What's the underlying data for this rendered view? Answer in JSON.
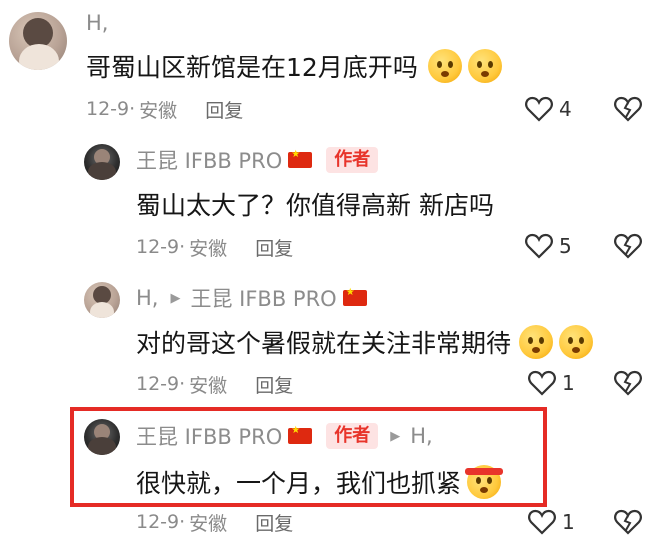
{
  "comments": [
    {
      "user": "H,",
      "text": "哥蜀山区新馆是在12月底开吗",
      "date": "12-9",
      "location": "安徽",
      "reply": "回复",
      "likes": "4",
      "emojis": 2
    },
    {
      "user": "王昆 IFBB PRO",
      "badge": "作者",
      "text": "蜀山太大了？你值得高新  新店吗",
      "date": "12-9",
      "location": "安徽",
      "reply": "回复",
      "likes": "5"
    },
    {
      "user": "H,",
      "reply_to": "王昆 IFBB PRO",
      "text": "对的哥这个暑假就在关注非常期待",
      "date": "12-9",
      "location": "安徽",
      "reply": "回复",
      "likes": "1"
    },
    {
      "user": "王昆 IFBB PRO",
      "badge": "作者",
      "reply_to": "H,",
      "text": "很快就，一个月，我们也抓紧",
      "date": "12-9",
      "location": "安徽",
      "reply": "回复",
      "likes": "1"
    }
  ],
  "colors": {
    "highlight": "#e52b25",
    "badge_text": "#e8342b",
    "badge_bg": "#fde3e3"
  },
  "icons": [
    "heart-outline-icon",
    "broken-heart-icon",
    "china-flag-icon",
    "thinking-emoji-icon",
    "striving-emoji-icon"
  ]
}
